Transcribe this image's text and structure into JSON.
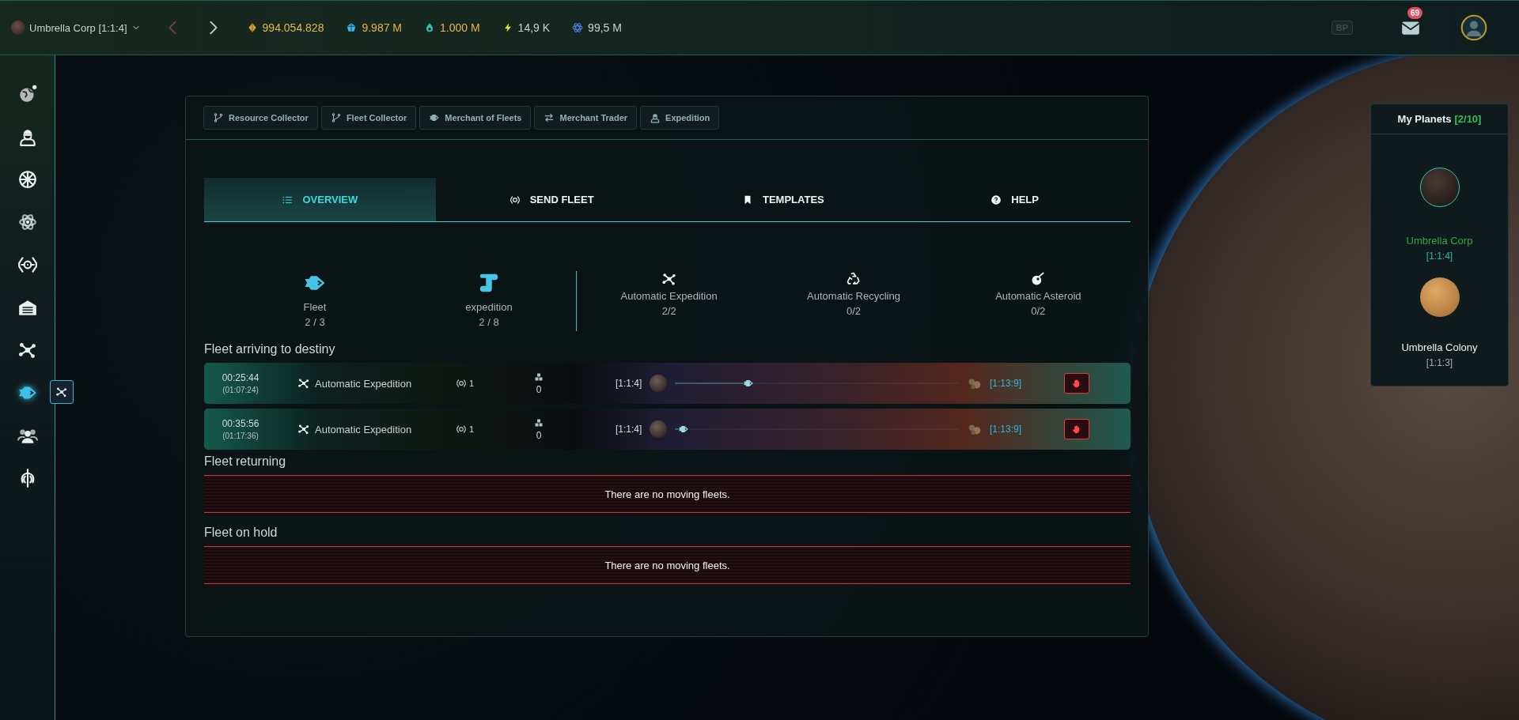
{
  "top_bar": {
    "planet_selector": "Umbrella Corp [1:1:4]",
    "resources": [
      {
        "kind": "metal",
        "value": "994.054.828",
        "color": "#e8b64c"
      },
      {
        "kind": "crystal",
        "value": "9.987 M",
        "color": "#e8b64c"
      },
      {
        "kind": "deuterium",
        "value": "1.000 M",
        "color": "#e8b64c"
      },
      {
        "kind": "energy",
        "value": "14,9 K",
        "color": "#c9d2d6"
      },
      {
        "kind": "dark_matter",
        "value": "99,5 M",
        "color": "#c9d2d6"
      }
    ],
    "bp_label": "BP",
    "mail_count": "69"
  },
  "sidebar": {
    "items": [
      {
        "kind": "globe",
        "selected": false
      },
      {
        "kind": "pilot",
        "selected": false
      },
      {
        "kind": "emblem",
        "selected": false
      },
      {
        "kind": "atom",
        "selected": false
      },
      {
        "kind": "tie",
        "selected": false
      },
      {
        "kind": "hangar",
        "selected": false
      },
      {
        "kind": "nodes",
        "selected": false
      },
      {
        "kind": "ship",
        "selected": true
      },
      {
        "kind": "users",
        "selected": false
      },
      {
        "kind": "crest",
        "selected": false
      }
    ],
    "flyout": {
      "kind": "nodes"
    }
  },
  "subnav": [
    {
      "kind": "branch",
      "label": "Resource Collector"
    },
    {
      "kind": "branch",
      "label": "Fleet Collector"
    },
    {
      "kind": "ship",
      "label": "Merchant of Fleets"
    },
    {
      "kind": "swap",
      "label": "Merchant Trader"
    },
    {
      "kind": "pilot",
      "label": "Expedition"
    }
  ],
  "tabs": [
    {
      "kind": "list",
      "label": "OVERVIEW",
      "selected": true
    },
    {
      "kind": "target",
      "label": "SEND FLEET",
      "selected": false
    },
    {
      "kind": "bookmark",
      "label": "TEMPLATES",
      "selected": false
    },
    {
      "kind": "help",
      "label": "HELP",
      "selected": false
    }
  ],
  "slots": {
    "fleet_slots": [
      {
        "kind": "ship",
        "label": "Fleet",
        "value": "2 / 3"
      },
      {
        "kind": "scroll",
        "label": "expedition",
        "value": "2 / 8"
      }
    ],
    "automatic": [
      {
        "kind": "nodes",
        "label": "Automatic Expedition",
        "value": "2/2"
      },
      {
        "kind": "recycle",
        "label": "Automatic Recycling",
        "value": "0/2"
      },
      {
        "kind": "asteroid",
        "label": "Automatic Asteroid",
        "value": "0/2"
      }
    ]
  },
  "sections": [
    {
      "title": "Fleet arriving to destiny",
      "rows": [
        {
          "time": "00:25:44",
          "total_time": "(01:07:24)",
          "mission": "Automatic Expedition",
          "ships": "1",
          "cargo": "0",
          "origin": "[1:1:4]",
          "destination": "[1:13:9]",
          "level": 0.25
        },
        {
          "time": "00:35:56",
          "total_time": "(01:17:36)",
          "mission": "Automatic Expedition",
          "ships": "1",
          "cargo": "0",
          "origin": "[1:1:4]",
          "destination": "[1:13:9]",
          "level": 0.02
        }
      ]
    },
    {
      "title": "Fleet returning",
      "empty_message": "There are no moving fleets."
    },
    {
      "title": "Fleet on hold",
      "empty_message": "There are no moving fleets."
    }
  ],
  "planets_panel": {
    "title": "My Planets",
    "count": "[2/10]",
    "planets": [
      {
        "name": "Umbrella Corp",
        "coords": "[1:1:4]",
        "selected": true
      },
      {
        "name": "Umbrella Colony",
        "coords": "[1:1:3]",
        "selected": false
      }
    ]
  }
}
